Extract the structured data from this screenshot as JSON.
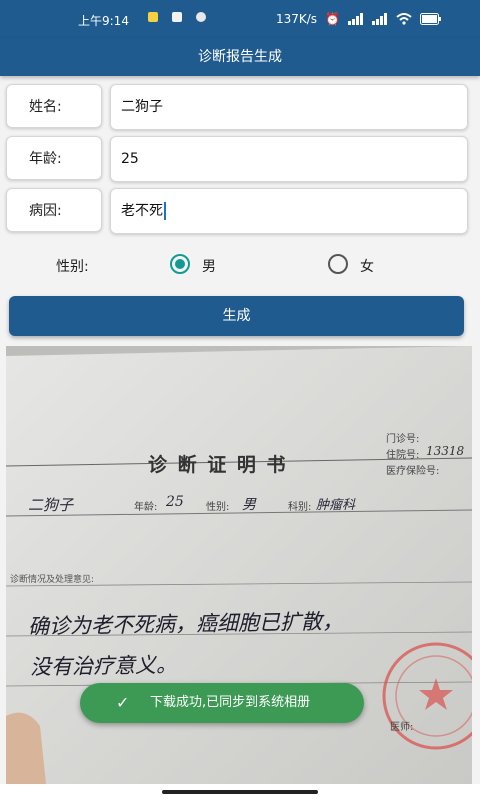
{
  "status_bar": {
    "time": "上午9:14",
    "network_speed": "137K/s",
    "icons": [
      "notification-yellow-icon",
      "notification-app-icon",
      "notification-app-icon-2",
      "alarm-icon",
      "signal-icon",
      "signal-icon-2",
      "wifi-icon",
      "battery-icon"
    ]
  },
  "app": {
    "title": "诊断报告生成"
  },
  "form": {
    "name": {
      "label": "姓名:",
      "value": "二狗子"
    },
    "age": {
      "label": "年龄:",
      "value": "25"
    },
    "cause": {
      "label": "病因:",
      "value": "老不死"
    },
    "gender": {
      "label": "性别:",
      "options": [
        {
          "label": "男",
          "selected": true
        },
        {
          "label": "女",
          "selected": false
        }
      ]
    },
    "generate_label": "生成"
  },
  "document": {
    "title": "诊 断 证 明 书",
    "side_fields": [
      "门诊号:",
      "住院号:",
      "医疗保险号:"
    ],
    "admission_no": "13318",
    "name_value": "二狗子",
    "age_label": "年龄:",
    "age_value": "25",
    "gender_label": "性别:",
    "gender_value": "男",
    "dept_label": "科别:",
    "dept_value": "肿瘤科",
    "section_label": "诊断情况及处理意见:",
    "handwriting_line1": "确诊为老不死病，癌细胞已扩散，",
    "handwriting_line2": "没有治疗意义。",
    "doctor_label": "医师:"
  },
  "toast": {
    "icon": "check-icon",
    "message": "下载成功,已同步到系统相册"
  },
  "colors": {
    "primary": "#1f5b8e",
    "radio_selected": "#129a93",
    "toast": "#3c9a55",
    "stamp": "#d9534f"
  }
}
